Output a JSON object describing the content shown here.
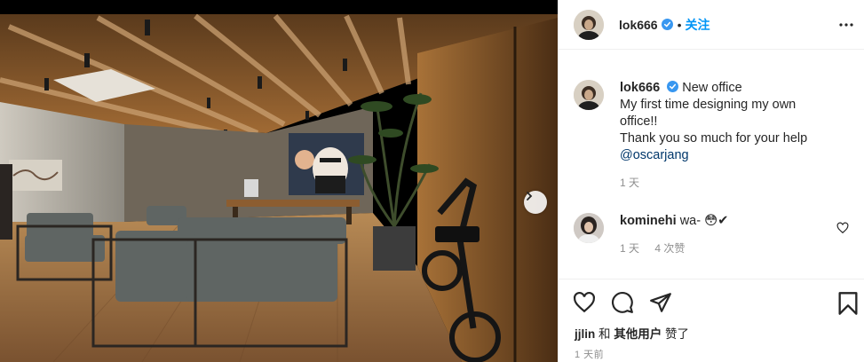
{
  "post": {
    "username": "lok666",
    "separator": "•",
    "follow_label": "关注",
    "caption": {
      "title": "New office",
      "line1": "My first time designing my own",
      "line2": "office!!",
      "line3": "Thank you so much for your help",
      "mention": "@oscarjang",
      "time": "1 天"
    },
    "comment": {
      "username": "kominehi",
      "text": "wa- 😳✔",
      "time": "1 天",
      "likes": "4 次赞"
    },
    "likes": {
      "first_user": "jjlin",
      "and": "和",
      "others": "其他用户",
      "suffix": "赞了"
    },
    "posted_time": "1 天前"
  },
  "colors": {
    "accent": "#0095f6",
    "verified": "#3897f0",
    "mention": "#00376b",
    "muted": "#8e8e8e"
  },
  "icons": [
    "verified-badge-icon",
    "more-options-icon",
    "heart-icon",
    "comment-icon",
    "share-icon",
    "bookmark-icon",
    "chevron-right-icon"
  ]
}
